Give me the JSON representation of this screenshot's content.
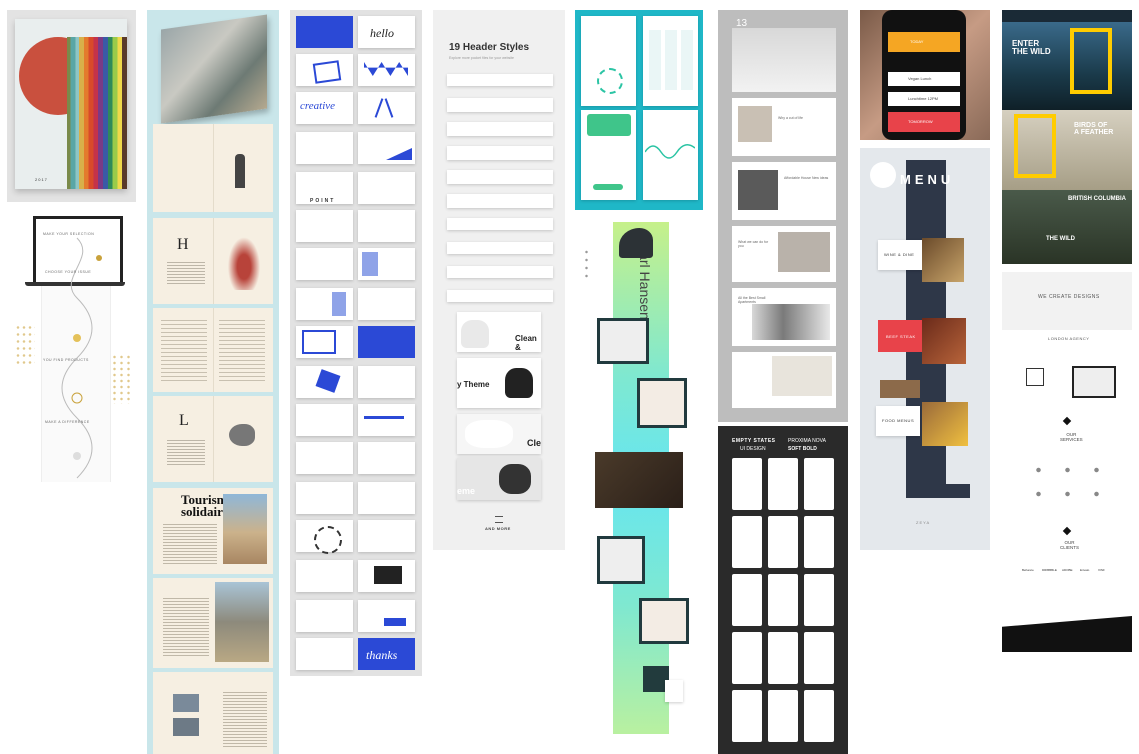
{
  "calendar": {
    "label": "2017"
  },
  "map_poster": {
    "labels": [
      "MAKE YOUR SELECTION",
      "CHOOSE YOUR ISSUE",
      "YOU FIND PRODUCTS",
      "MAKE A DIFFERENCE"
    ]
  },
  "magazine": {
    "letter_h": "H",
    "letter_l": "L",
    "tourisme_title": "Tourisme\nsolidaire"
  },
  "lettering": {
    "words": [
      "hello",
      "creative",
      "point",
      "thanks"
    ],
    "point_label": "POINT"
  },
  "header_styles": {
    "title": "19 Header Styles",
    "subtitle": "Explore more pocket files for your website",
    "strips": [
      "",
      "",
      "",
      "",
      "",
      "",
      "",
      "",
      "",
      "",
      "",
      "",
      ""
    ],
    "theme_text": "y Theme",
    "clean_text": "Clean &",
    "cle_text": "Cle",
    "eme_text": "eme",
    "and_more": "AND MORE"
  },
  "app_screens": {
    "screens": [
      "Login with fingerprint",
      "Dashboard",
      "Cards",
      "Statistics"
    ]
  },
  "chair": {
    "vertical_name": "Carl Hansen"
  },
  "interior": {
    "date_label": "13",
    "captions": [
      "Why a cut of life",
      "Affordable House New ideas",
      "What we can do for you",
      "All the Best Small Apartments"
    ]
  },
  "empty_states": {
    "title": "EMPTY STATES",
    "subtitle": "UI DESIGN",
    "font": "PROXIMA NOVA",
    "font_weight": "SOFT BOLD",
    "cards": [
      "",
      "",
      "",
      "",
      "",
      "",
      "",
      "",
      "",
      "",
      "",
      "",
      "",
      "",
      ""
    ]
  },
  "phone": {
    "rows": [
      "TODAY",
      "Vegan Lunch",
      "Lunchtime 12PM",
      "TOMORROW"
    ]
  },
  "menu": {
    "title": "MENU",
    "cards": [
      "WINE & DINE",
      "BEEF STEAK",
      "FOOD MENUS"
    ],
    "footer": "ZEYA"
  },
  "natgeo": {
    "hero_title": "ENTER\nTHE WILD",
    "birds_title": "BIRDS OF\nA FEATHER",
    "bc_title": "BRITISH COLUMBIA",
    "wild_title": "THE WILD"
  },
  "agency": {
    "headline": "WE CREATE DESIGNS",
    "agency": "LONDON AGENCY",
    "services": "OUR\nSERVICES",
    "clients": "OUR\nCLIENTS",
    "client_logos": [
      "Behance",
      "DRIBBBLE",
      "ADOBE",
      "Envato",
      "XINF"
    ]
  },
  "colors": {
    "blue": "#2b49d6",
    "teal": "#1fb7c7",
    "dark": "#2a2a2a",
    "yellow": "#ffcc00",
    "phone_orange": "#f5a623",
    "phone_red": "#e8434a"
  }
}
